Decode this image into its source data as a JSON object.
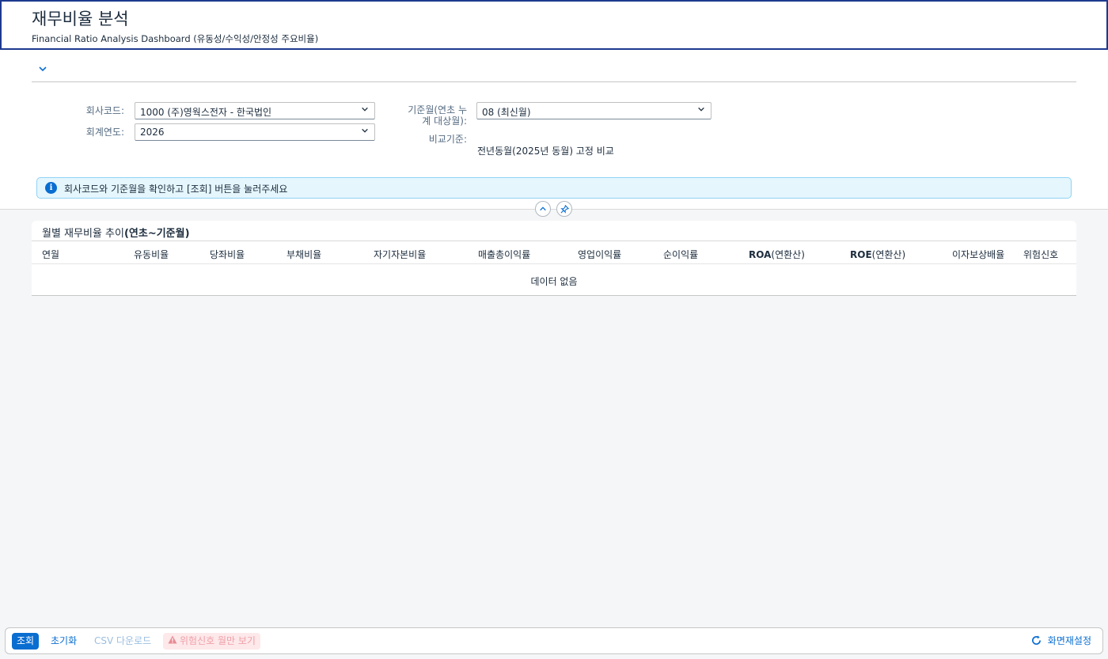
{
  "header": {
    "title": "재무비율 분석",
    "subtitle": "Financial Ratio Analysis Dashboard (유동성/수익성/안정성 주요비율)"
  },
  "filters": {
    "company_label": "회사코드:",
    "company_value": "1000 (주)영웍스전자 - 한국법인",
    "year_label": "회계연도:",
    "year_value": "2026",
    "month_label_line1": "기준월(연초 누",
    "month_label_line2": "계 대상월):",
    "month_value": "08 (최신월)",
    "compare_label": "비교기준:",
    "compare_value": "전년동월(2025년 동월) 고정 비교"
  },
  "info": {
    "message": "회사코드와 기준월을 확인하고 [조회] 버튼을 눌러주세요"
  },
  "table": {
    "title_prefix": "월별 재무비율 추이",
    "title_suffix": "(연초~기준월)",
    "columns": [
      "연월",
      "유동비율",
      "당좌비율",
      "부채비율",
      "자기자본비율",
      "매출총이익률",
      "영업이익률",
      "순이익률",
      "ROA",
      "(연환산)",
      "ROE",
      "(연환산)",
      "이자보상배율",
      "위험신호"
    ],
    "empty_text": "데이터 없음"
  },
  "footer": {
    "search_label": "조회",
    "reset_label": "초기화",
    "csv_label": "CSV 다운로드",
    "risk_label": "위험신호 월만 보기",
    "restore_label": "화면재설정"
  },
  "icons": {
    "expand": "chevron-down-icon",
    "collapse": "chevron-up-icon",
    "pin": "pin-icon",
    "info": "info-icon",
    "warning": "warning-icon",
    "refresh": "refresh-icon"
  },
  "colors": {
    "accent": "#0a6ed1",
    "info_bg": "#e5f6fd",
    "header_border": "#1d3a8f"
  }
}
